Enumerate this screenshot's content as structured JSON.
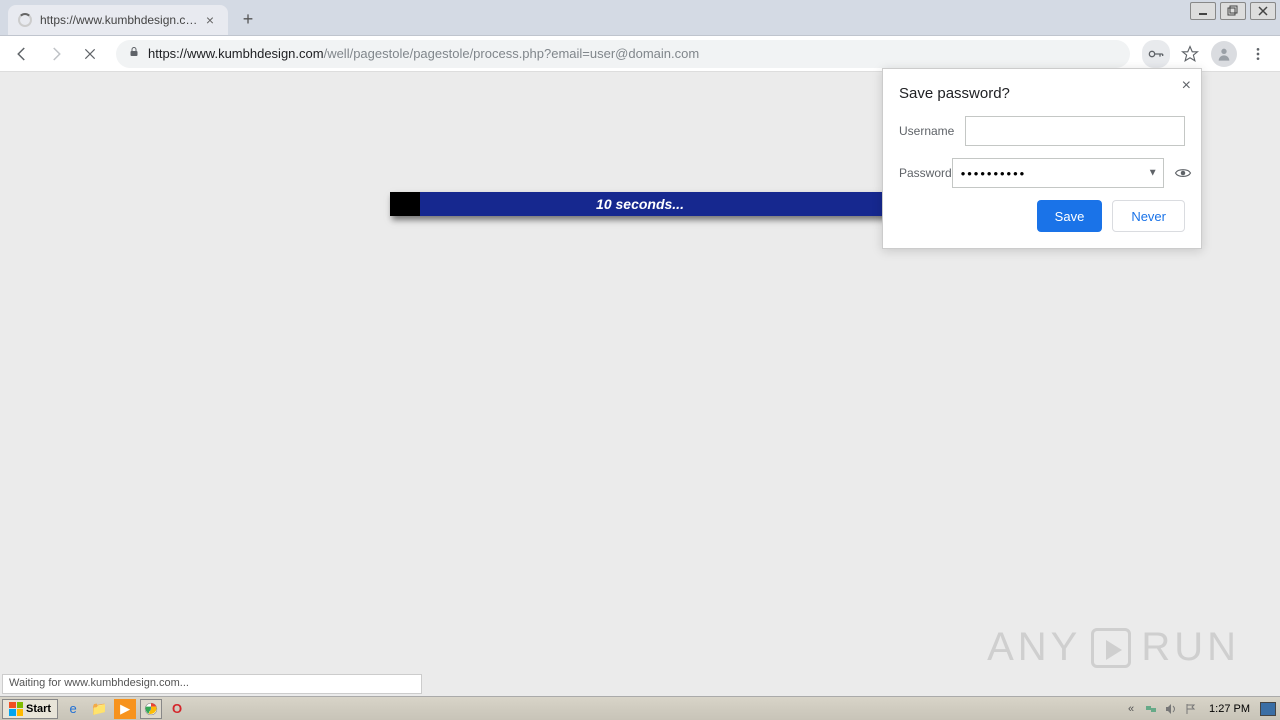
{
  "tab": {
    "title": "https://www.kumbhdesign.com/well"
  },
  "url": {
    "host": "https://www.kumbhdesign.com",
    "path": "/well/pagestole/pagestole/process.php?email=user@domain.com"
  },
  "progress": {
    "text": "10 seconds..."
  },
  "dialog": {
    "title": "Save password?",
    "username_label": "Username",
    "username_value": "",
    "password_label": "Password",
    "password_value": "••••••••••",
    "save": "Save",
    "never": "Never"
  },
  "status": "Waiting for www.kumbhdesign.com...",
  "watermark": {
    "left": "ANY",
    "right": "RUN"
  },
  "taskbar": {
    "start": "Start",
    "clock": "1:27 PM"
  }
}
